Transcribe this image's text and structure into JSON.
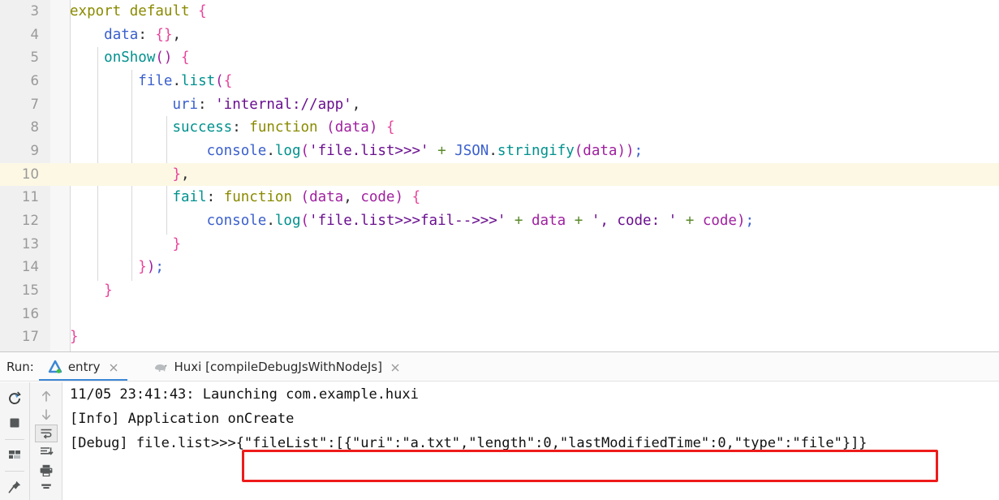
{
  "editor": {
    "first_line_number": 3,
    "highlighted_line": 10,
    "lines": [
      {
        "num": "3",
        "text": "export default {"
      },
      {
        "num": "4",
        "text": "    data: {},"
      },
      {
        "num": "5",
        "text": "    onShow() {"
      },
      {
        "num": "6",
        "text": "        file.list({"
      },
      {
        "num": "7",
        "text": "            uri: 'internal://app',"
      },
      {
        "num": "8",
        "text": "            success: function (data) {"
      },
      {
        "num": "9",
        "text": "                console.log('file.list>>>' + JSON.stringify(data));"
      },
      {
        "num": "10",
        "text": "            },"
      },
      {
        "num": "11",
        "text": "            fail: function (data, code) {"
      },
      {
        "num": "12",
        "text": "                console.log('file.list>>>fail-->>>' + data + ', code: ' + code);"
      },
      {
        "num": "13",
        "text": "            }"
      },
      {
        "num": "14",
        "text": "        });"
      },
      {
        "num": "15",
        "text": "    }"
      },
      {
        "num": "16",
        "text": ""
      },
      {
        "num": "17",
        "text": "}"
      }
    ]
  },
  "run_panel": {
    "label": "Run:",
    "tabs": [
      {
        "label": "entry",
        "icon": "app-delta-icon",
        "active": true,
        "close_icon": "close-icon"
      },
      {
        "label": "Huxi [compileDebugJsWithNodeJs]",
        "icon": "gradle-elephant-icon",
        "active": false,
        "close_icon": "close-icon"
      }
    ],
    "toolbar_left": [
      {
        "name": "rerun-icon"
      },
      {
        "name": "stop-icon"
      },
      {
        "name": "separator"
      },
      {
        "name": "layout-icon"
      },
      {
        "name": "separator"
      },
      {
        "name": "pin-tab-icon"
      }
    ],
    "toolbar_right": [
      {
        "name": "up-arrow-icon"
      },
      {
        "name": "down-arrow-icon"
      },
      {
        "name": "soft-wrap-icon",
        "selected": true
      },
      {
        "name": "scroll-to-end-icon"
      },
      {
        "name": "print-icon"
      },
      {
        "name": "clear-all-icon"
      }
    ],
    "console_lines": [
      {
        "text": "11/05 23:41:43: Launching com.example.huxi"
      },
      {
        "text": "[Info] Application onCreate"
      },
      {
        "text": "[Debug] file.list>>>{\"fileList\":[{\"uri\":\"a.txt\",\"length\":0,\"lastModifiedTime\":0,\"type\":\"file\"}]}"
      }
    ],
    "highlight_box": {
      "color": "#ee1b1b",
      "content": "{\"fileList\":[{\"uri\":\"a.txt\",\"length\":0,\"lastModifiedTime\":0,\"type\":\"file\"}]}"
    }
  },
  "colors": {
    "keyword": "#8a8a00",
    "property": "#3a5fcd",
    "function": "#00918e",
    "brace": "#e8449b",
    "string": "#6a0f8f",
    "operator": "#5a8a2a",
    "highlight_line": "#fdf8e4",
    "accent_tab": "#3c87d6",
    "red_box": "#ee1b1b"
  }
}
